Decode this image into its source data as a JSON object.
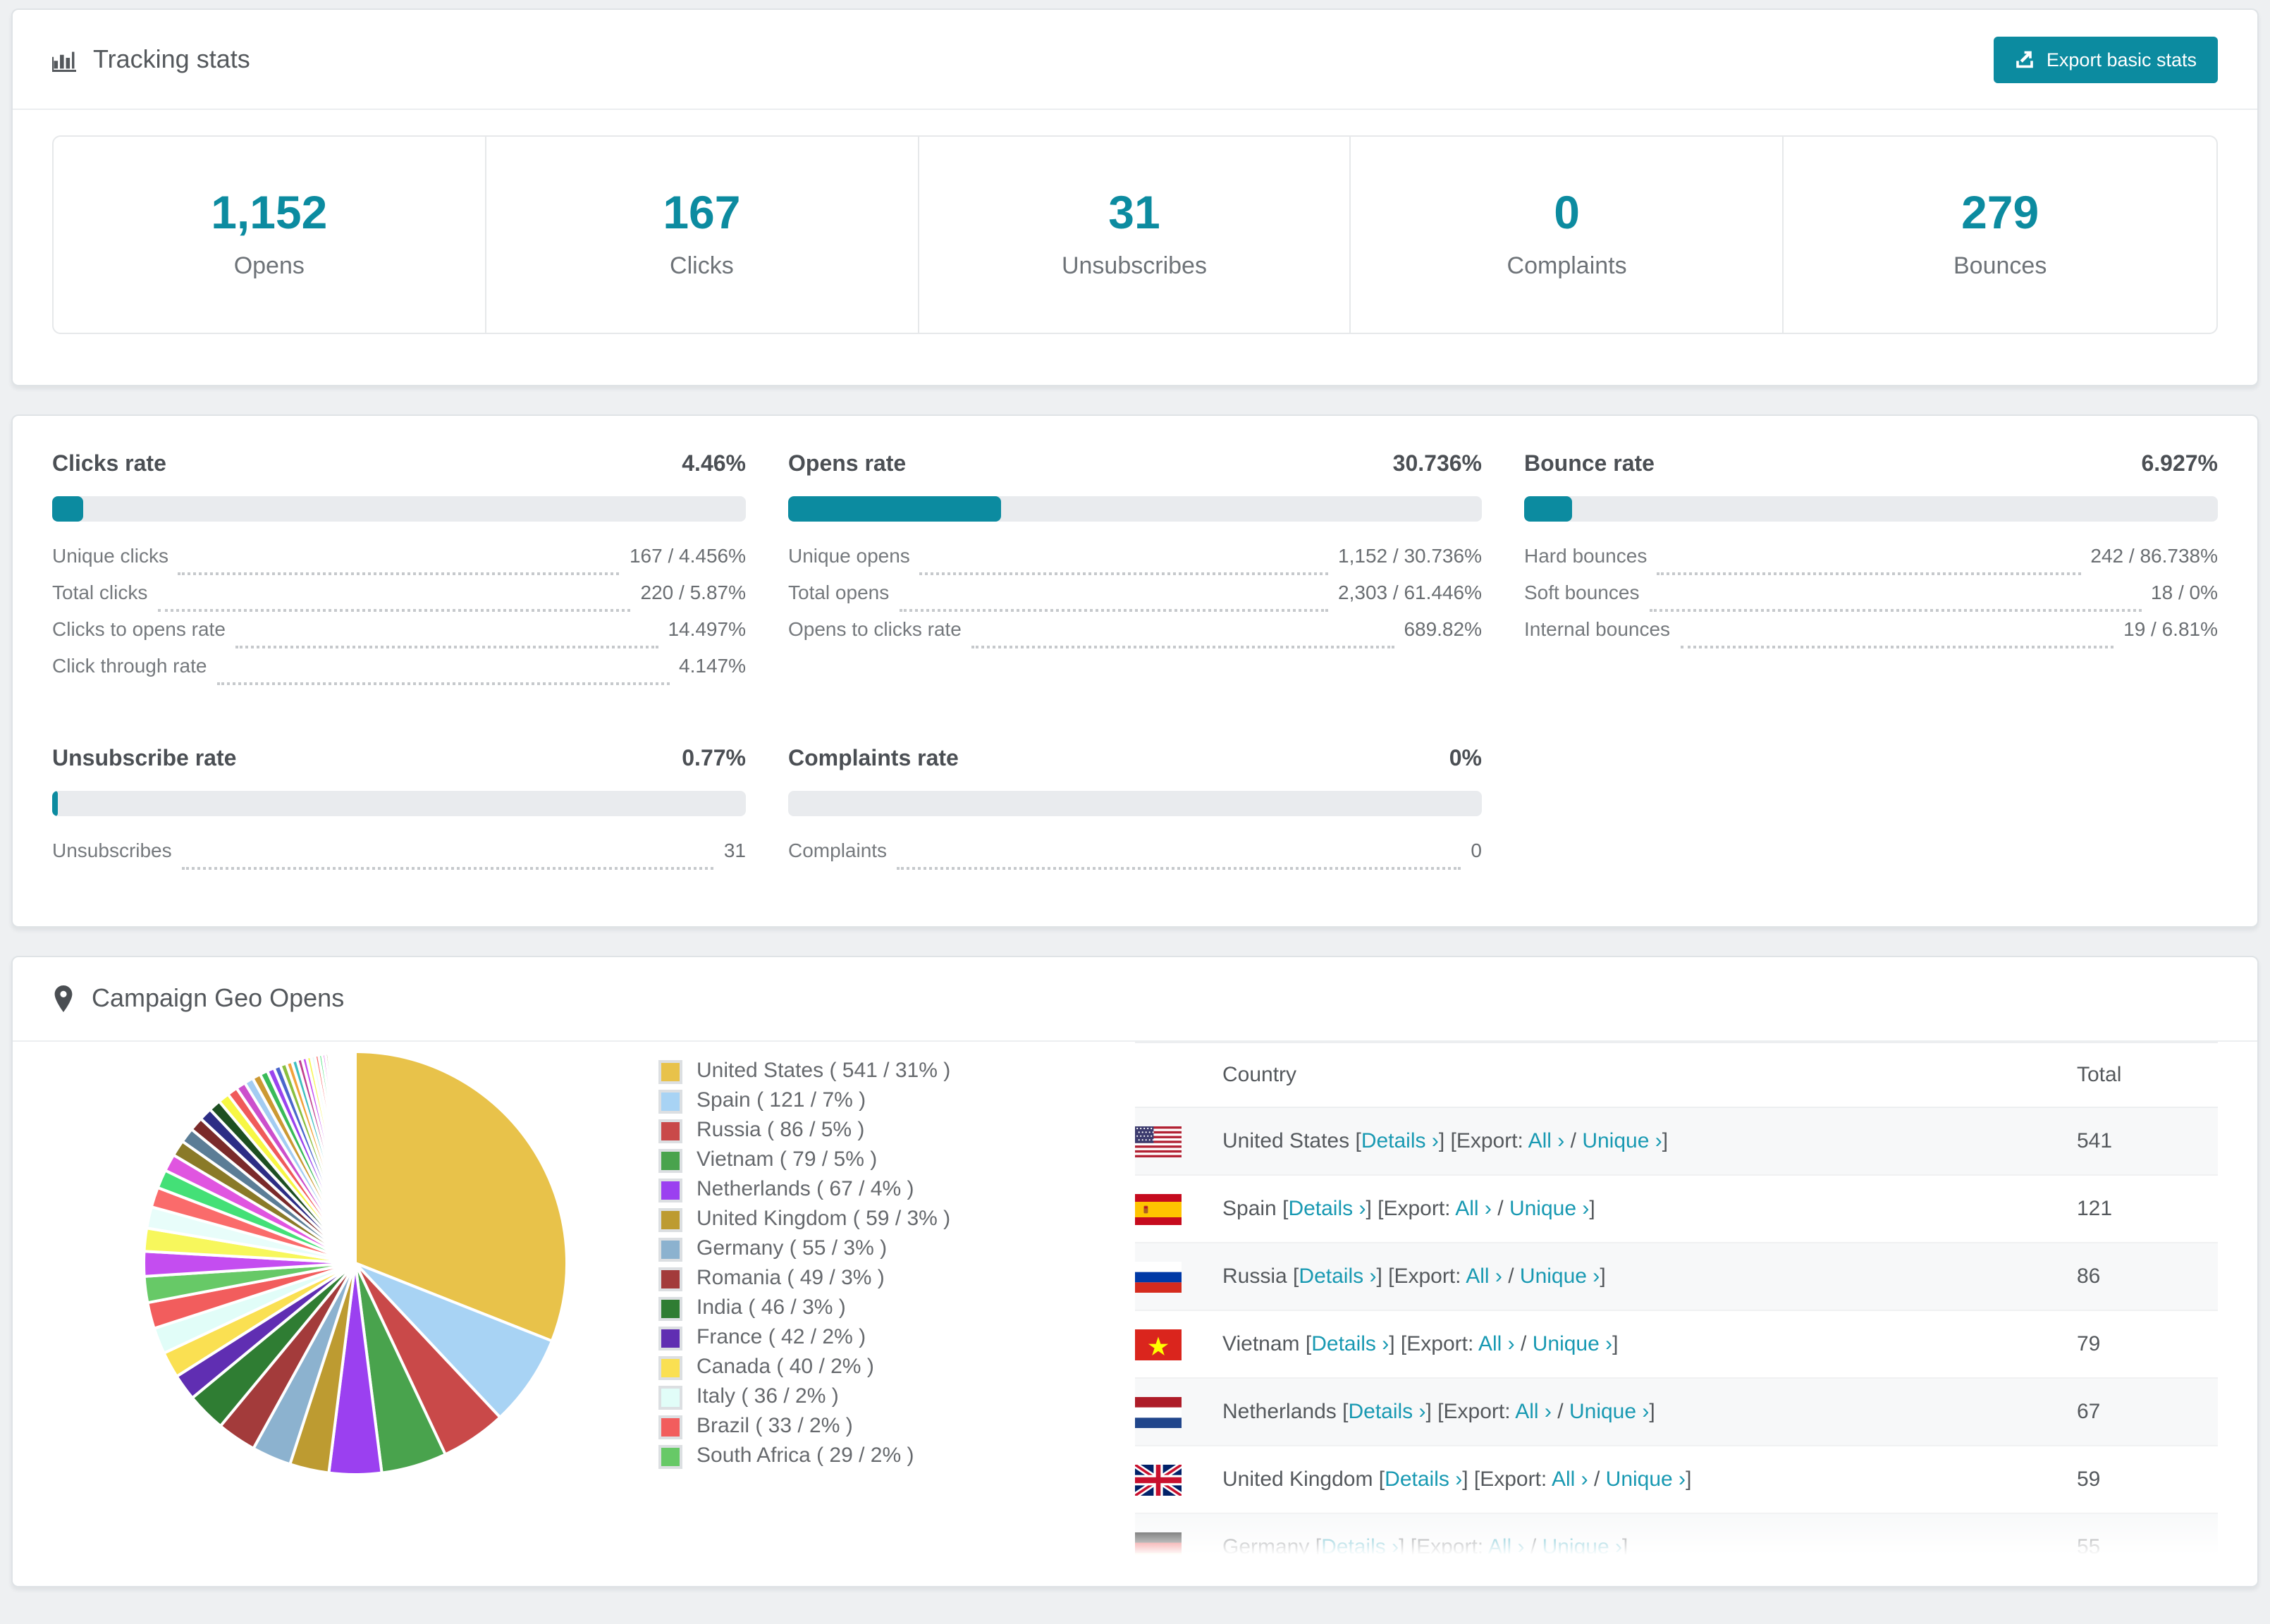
{
  "tracking": {
    "title": "Tracking stats",
    "export_label": "Export basic stats",
    "summary": [
      {
        "value": "1,152",
        "label": "Opens"
      },
      {
        "value": "167",
        "label": "Clicks"
      },
      {
        "value": "31",
        "label": "Unsubscribes"
      },
      {
        "value": "0",
        "label": "Complaints"
      },
      {
        "value": "279",
        "label": "Bounces"
      }
    ]
  },
  "rates": {
    "sections": [
      {
        "title": "Clicks rate",
        "value": "4.46%",
        "percent": 4.46,
        "rows": [
          {
            "label": "Unique clicks",
            "value": "167 / 4.456%"
          },
          {
            "label": "Total clicks",
            "value": "220 / 5.87%"
          },
          {
            "label": "Clicks to opens rate",
            "value": "14.497%"
          },
          {
            "label": "Click through rate",
            "value": "4.147%"
          }
        ]
      },
      {
        "title": "Opens rate",
        "value": "30.736%",
        "percent": 30.736,
        "rows": [
          {
            "label": "Unique opens",
            "value": "1,152 / 30.736%"
          },
          {
            "label": "Total opens",
            "value": "2,303 / 61.446%"
          },
          {
            "label": "Opens to clicks rate",
            "value": "689.82%"
          }
        ]
      },
      {
        "title": "Bounce rate",
        "value": "6.927%",
        "percent": 6.927,
        "rows": [
          {
            "label": "Hard bounces",
            "value": "242 / 86.738%"
          },
          {
            "label": "Soft bounces",
            "value": "18 / 0%"
          },
          {
            "label": "Internal bounces",
            "value": "19 / 6.81%"
          }
        ]
      },
      {
        "title": "Unsubscribe rate",
        "value": "0.77%",
        "percent": 0.77,
        "rows": [
          {
            "label": "Unsubscribes",
            "value": "31"
          }
        ]
      },
      {
        "title": "Complaints rate",
        "value": "0%",
        "percent": 0,
        "rows": [
          {
            "label": "Complaints",
            "value": "0"
          }
        ]
      }
    ]
  },
  "geo": {
    "title": "Campaign Geo Opens",
    "table": {
      "col_country": "Country",
      "col_total": "Total",
      "link_details": "Details",
      "export_prefix": "Export:",
      "link_all": "All",
      "link_unique": "Unique",
      "chevron": "›",
      "visible_rows": 7
    }
  },
  "chart_data": {
    "type": "pie",
    "title": "Campaign Geo Opens",
    "legend_position": "right",
    "start_angle_deg": 0,
    "direction": "clockwise",
    "series": [
      {
        "label": "United States",
        "value": 541,
        "pct": 31,
        "color": "#e8c24a",
        "flag": "us"
      },
      {
        "label": "Spain",
        "value": 121,
        "pct": 7,
        "color": "#a8d3f4",
        "flag": "es"
      },
      {
        "label": "Russia",
        "value": 86,
        "pct": 5,
        "color": "#c94949",
        "flag": "ru"
      },
      {
        "label": "Vietnam",
        "value": 79,
        "pct": 5,
        "color": "#49a34d",
        "flag": "vn"
      },
      {
        "label": "Netherlands",
        "value": 67,
        "pct": 4,
        "color": "#9b40f0",
        "flag": "nl"
      },
      {
        "label": "United Kingdom",
        "value": 59,
        "pct": 3,
        "color": "#bd9b31",
        "flag": "gb"
      },
      {
        "label": "Germany",
        "value": 55,
        "pct": 3,
        "color": "#8cb2cf",
        "flag": "de"
      },
      {
        "label": "Romania",
        "value": 49,
        "pct": 3,
        "color": "#a33b3b",
        "flag": "ro"
      },
      {
        "label": "India",
        "value": 46,
        "pct": 3,
        "color": "#2f7d33",
        "flag": "in"
      },
      {
        "label": "France",
        "value": 42,
        "pct": 2,
        "color": "#602eb2",
        "flag": "fr"
      },
      {
        "label": "Canada",
        "value": 40,
        "pct": 2,
        "color": "#fae052",
        "flag": "ca"
      },
      {
        "label": "Italy",
        "value": 36,
        "pct": 2,
        "color": "#e1fdf8",
        "flag": "it"
      },
      {
        "label": "Brazil",
        "value": 33,
        "pct": 2,
        "color": "#f25d5d",
        "flag": "br"
      },
      {
        "label": "South Africa",
        "value": 29,
        "pct": 2,
        "color": "#67c967",
        "flag": "za"
      }
    ],
    "others_total_pct": 26,
    "others_colors": [
      "#c44df0",
      "#f7f75c",
      "#e8fdfa",
      "#fa6b6b",
      "#44e077",
      "#e055e0",
      "#8a7a28",
      "#5b7d96",
      "#7a2a2a",
      "#2d2d85",
      "#1d4f21",
      "#f7f744",
      "#f05a5a",
      "#cc4fcc",
      "#a3ccf2",
      "#cc9933",
      "#39bb58",
      "#9a44ee",
      "#4a66cc",
      "#8abf3f",
      "#f2a33c",
      "#3fbfbf",
      "#bf3f8f"
    ]
  },
  "colors": {
    "accent_teal": "#0c8ba0",
    "link_teal": "#1899b2",
    "page_bg": "#eef0f2"
  }
}
